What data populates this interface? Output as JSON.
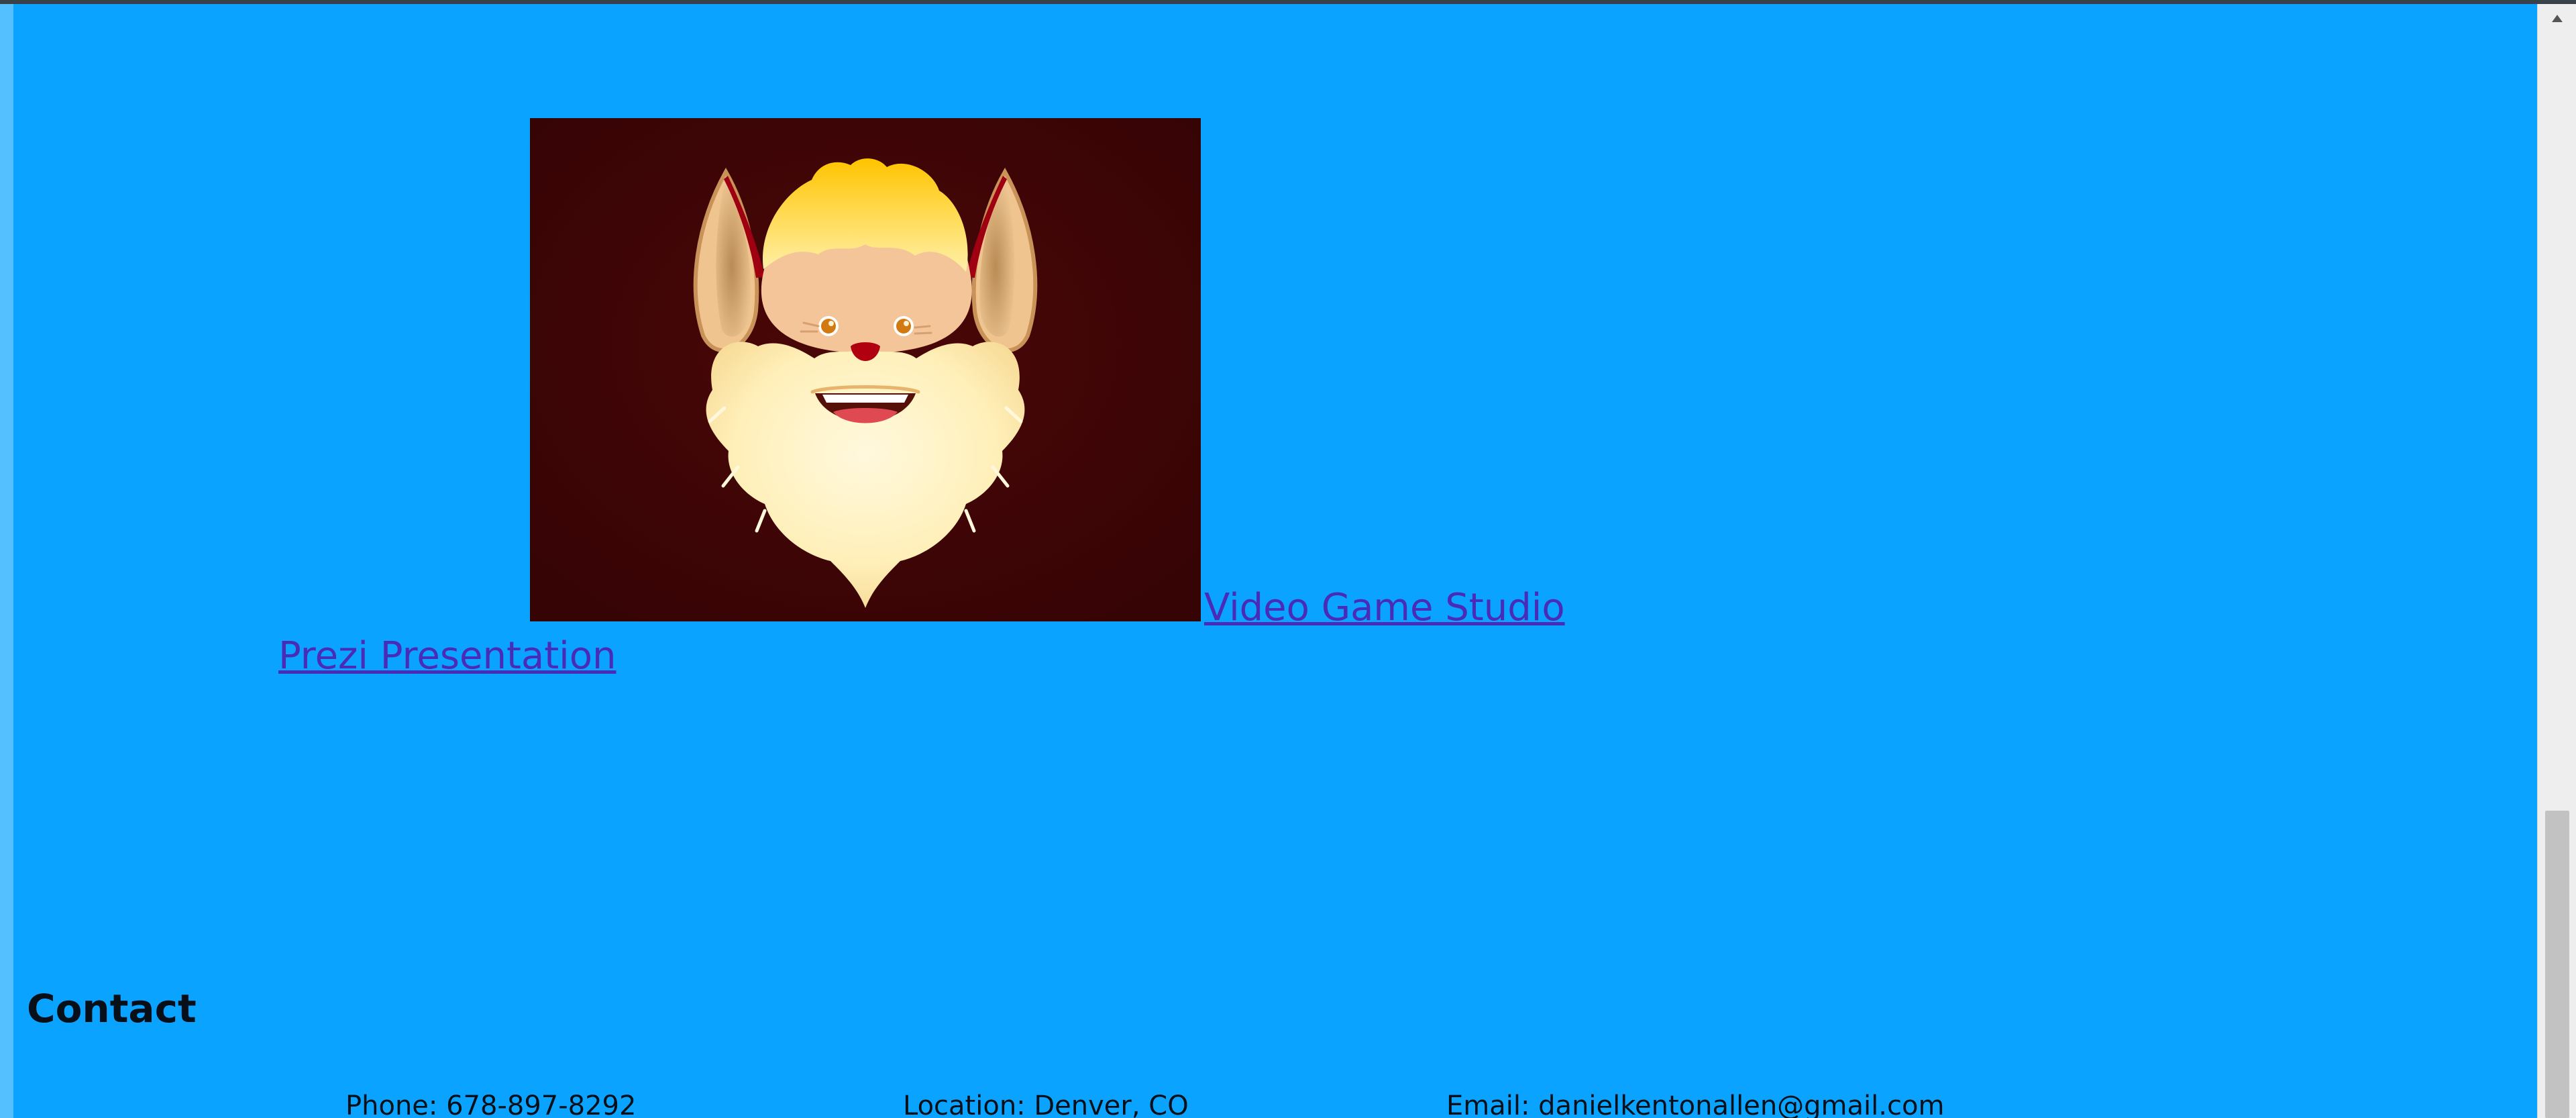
{
  "portfolio": {
    "image_alt": "bearded mascot face",
    "video_game_link": "Video Game Studio",
    "prezi_link": "Prezi Presentation"
  },
  "contact": {
    "heading": "Contact",
    "phone": "Phone: 678-897-8292",
    "location": "Location: Denver, CO",
    "email": "Email: danielkentonallen@gmail.com"
  },
  "colors": {
    "page_background": "#0aa3ff",
    "link": "#4a2bb8",
    "image_background": "#370405"
  }
}
